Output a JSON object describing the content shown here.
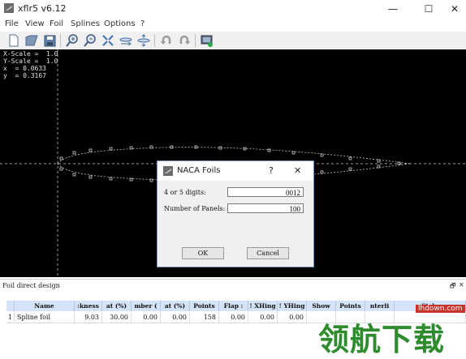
{
  "window": {
    "title": "xflr5 v6.12",
    "minimize_glyph": "—",
    "maximize_glyph": "☐",
    "close_glyph": "✕",
    "app_icon": "xflr5-icon"
  },
  "menu": [
    "File",
    "View",
    "Foil",
    "Splines",
    "Options",
    "?"
  ],
  "toolbar": {
    "icons": [
      "new-file-icon",
      "open-folder-icon",
      "save-icon",
      "zoom-in-icon",
      "zoom-out-icon",
      "reset-view-icon",
      "reset-x-scale-icon",
      "reset-y-scale-icon",
      "undo-icon",
      "redo-icon",
      "store-foil-icon"
    ]
  },
  "canvas": {
    "background": "#000000",
    "readout": {
      "x_scale": "X-Scale =  1.0",
      "y_scale": "Y-Scale =  1.0",
      "x": "x  = 0.0633",
      "y": "y  = 0.3167"
    }
  },
  "dialog": {
    "title": "NACA Foils",
    "help_glyph": "?",
    "close_glyph": "✕",
    "digits_label": "4 or 5 digits:",
    "digits_value": "0012",
    "panels_label": "Number of Panels:",
    "panels_value": "100",
    "ok_label": "OK",
    "cancel_label": "Cancel"
  },
  "panel": {
    "title": "Foil direct design",
    "restore_glyph": "🗗",
    "close_glyph": "✕"
  },
  "table": {
    "columns": [
      "",
      "Name",
      ":kness",
      "at (%)",
      "mber (",
      "at (%)",
      "Points",
      "Flap :",
      "! XHing",
      "! YHing",
      "Show",
      "Points",
      "nterli",
      "Style"
    ],
    "rows": [
      [
        "1",
        "Spline foil",
        "9.03",
        "30.00",
        "0.00",
        "0.00",
        "158",
        "0.00",
        "0.00",
        "0.00",
        "",
        "",
        "",
        ""
      ]
    ]
  },
  "watermark": {
    "site": "lhdown.com",
    "text": "领航下载"
  }
}
